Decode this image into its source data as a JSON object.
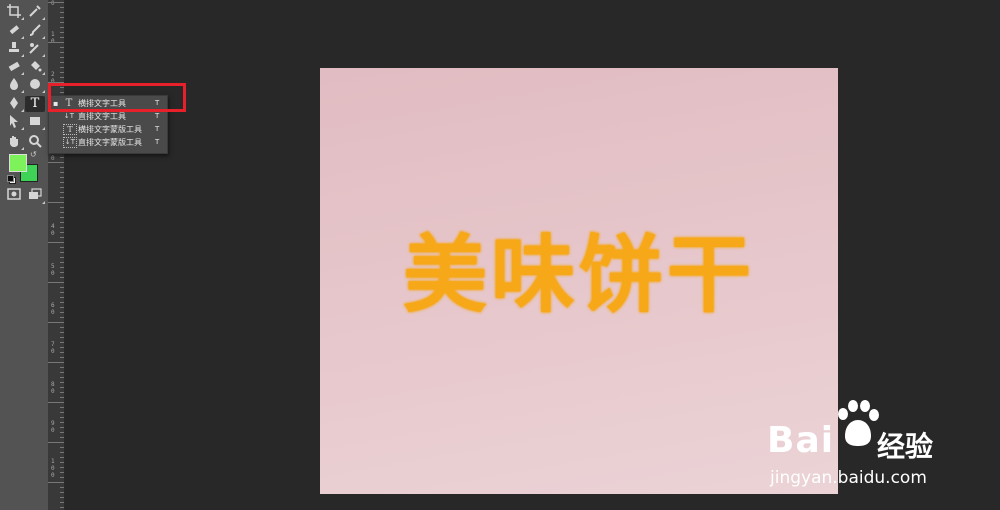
{
  "flyout_menu": {
    "items": [
      {
        "bullet": "▪",
        "icon": "T",
        "label": "横排文字工具",
        "shortcut": "T"
      },
      {
        "bullet": "",
        "icon": "↓T",
        "label": "直排文字工具",
        "shortcut": "T"
      },
      {
        "bullet": "",
        "icon": "T",
        "label": "横排文字蒙版工具",
        "shortcut": "T"
      },
      {
        "bullet": "",
        "icon": "↓T",
        "label": "直排文字蒙版工具",
        "shortcut": "T"
      }
    ]
  },
  "canvas": {
    "text": "美味饼干",
    "text_color": "#f6a819",
    "background_color": "#e5c4c9"
  },
  "ruler": {
    "labels": [
      "0",
      "1\n0",
      "2\n0",
      "3\n0",
      "4\n0",
      "5\n0",
      "6\n0",
      "7\n0",
      "8\n0",
      "9\n0",
      "1\n0\n0"
    ]
  },
  "tools": {
    "foreground_color": "#7df25a",
    "background_color": "#3ed256",
    "active_tool": "type-tool",
    "type_tool_label": "T"
  },
  "watermark": {
    "brand": "Bai",
    "name": "经验",
    "url": "jingyan.baidu.com"
  },
  "highlight_color": "#e8202a"
}
